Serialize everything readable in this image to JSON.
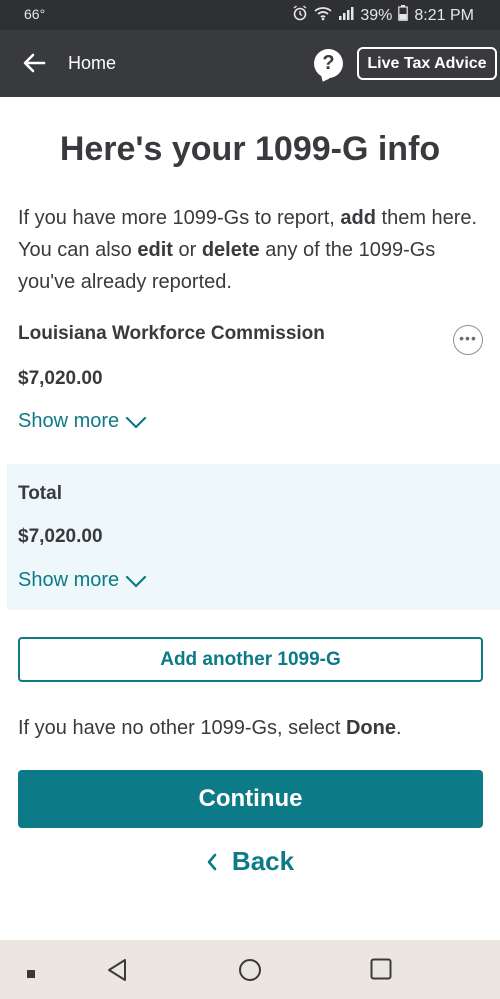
{
  "status_bar": {
    "temperature": "66°",
    "battery": "39%",
    "time": "8:21 PM"
  },
  "header": {
    "home_label": "Home",
    "help_symbol": "?",
    "live_tax_advice_label": "Live Tax Advice"
  },
  "page": {
    "title": "Here's your 1099-G info",
    "intro": {
      "part1": "If you have more 1099-Gs to report, ",
      "bold1": "add",
      "part2": " them here. You can also ",
      "bold2": "edit",
      "part3": " or ",
      "bold3": "delete",
      "part4": " any of the 1099-Gs you've already reported."
    },
    "entry": {
      "payer_name": "Louisiana Workforce Commission",
      "amount": "$7,020.00",
      "show_more_label": "Show more",
      "more_options_symbol": "•••"
    },
    "total": {
      "label": "Total",
      "amount": "$7,020.00",
      "show_more_label": "Show more"
    },
    "add_another_label": "Add another 1099-G",
    "done_prompt": {
      "text": "If you have no other 1099-Gs, select ",
      "bold": "Done",
      "end": "."
    },
    "continue_label": "Continue",
    "back_label": "Back"
  },
  "colors": {
    "accent": "#0d7a87",
    "header_bg": "#393a3d",
    "total_bg": "#eef8fb"
  },
  "icons": {
    "status": [
      "alarm-icon",
      "wifi-icon",
      "signal-icon",
      "battery-icon"
    ],
    "nav": [
      "nav-back-icon",
      "nav-home-icon",
      "nav-recents-icon"
    ]
  }
}
